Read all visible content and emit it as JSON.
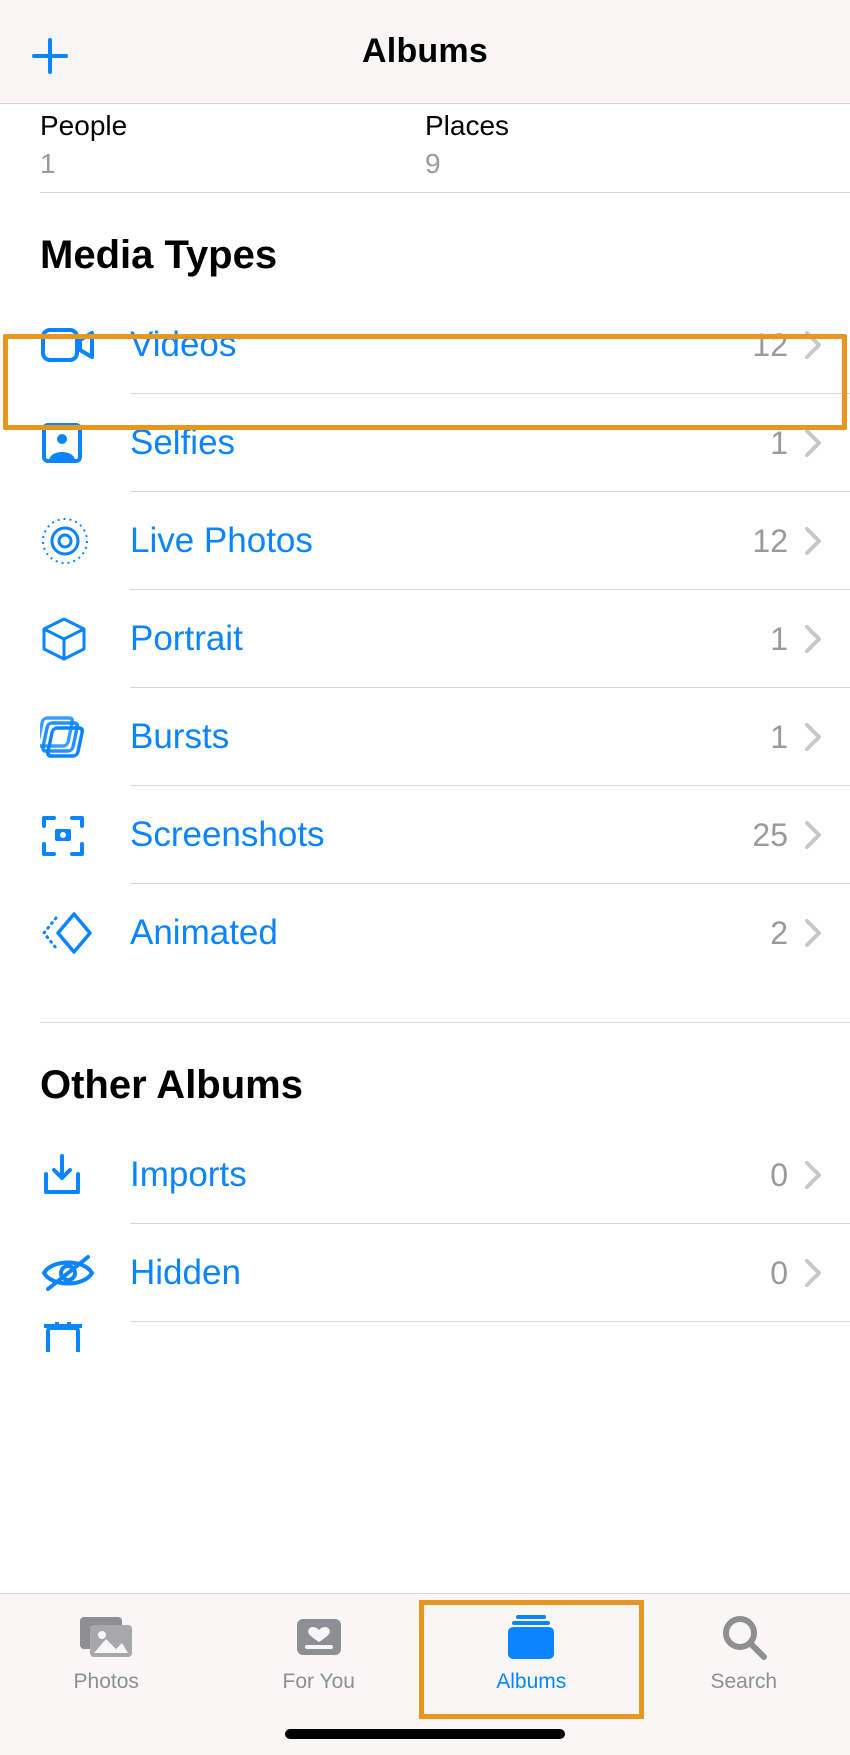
{
  "header": {
    "title": "Albums"
  },
  "sub": [
    {
      "title": "People",
      "count": "1"
    },
    {
      "title": "Places",
      "count": "9"
    }
  ],
  "sections": {
    "media_types": {
      "title": "Media Types",
      "rows": [
        {
          "icon": "video",
          "label": "Videos",
          "count": "12"
        },
        {
          "icon": "selfie",
          "label": "Selfies",
          "count": "1"
        },
        {
          "icon": "live",
          "label": "Live Photos",
          "count": "12"
        },
        {
          "icon": "portrait",
          "label": "Portrait",
          "count": "1"
        },
        {
          "icon": "bursts",
          "label": "Bursts",
          "count": "1"
        },
        {
          "icon": "screenshots",
          "label": "Screenshots",
          "count": "25"
        },
        {
          "icon": "animated",
          "label": "Animated",
          "count": "2"
        }
      ]
    },
    "other_albums": {
      "title": "Other Albums",
      "rows": [
        {
          "icon": "imports",
          "label": "Imports",
          "count": "0"
        },
        {
          "icon": "hidden",
          "label": "Hidden",
          "count": "0"
        }
      ]
    }
  },
  "tabs": [
    {
      "id": "photos",
      "label": "Photos"
    },
    {
      "id": "foryou",
      "label": "For You"
    },
    {
      "id": "albums",
      "label": "Albums",
      "active": true
    },
    {
      "id": "search",
      "label": "Search"
    }
  ]
}
